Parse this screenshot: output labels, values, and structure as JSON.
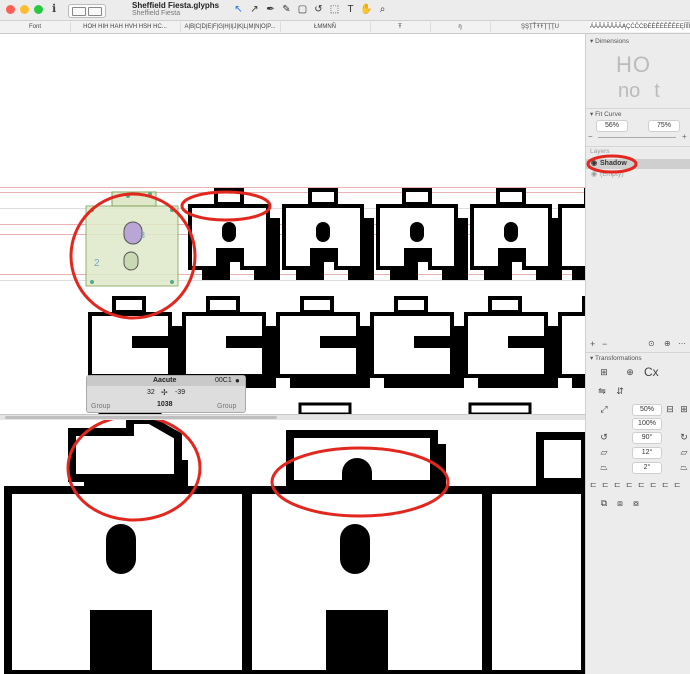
{
  "window": {
    "title": "Sheffield Fiesta.glyphs",
    "subtitle": "Sheffield Fiesta"
  },
  "tabs": [
    {
      "label": "Font"
    },
    {
      "label": "HOH HIH HAH HVH HSH HC..."
    },
    {
      "label": "A|B|C|D|E|F|G|H|I|J|K|L|M|N|O|P..."
    },
    {
      "label": "ŁMMNŇ"
    },
    {
      "label": "Ŧ"
    },
    {
      "label": "ŋ"
    },
    {
      "label": "ŞŞŢŤŦŦŢŢŢU"
    },
    {
      "label": "ÁÀÂÄÃÅĀĂĄÇĆĈĊĐÉÈÊËĒĚĔĖĘÍÌÎÏĨĮ..."
    }
  ],
  "toolbar": {
    "icons": [
      "select-arrow-icon",
      "select-arrow-alt-icon",
      "draw-pen-icon",
      "pencil-icon",
      "rectangle-icon",
      "rotate-icon",
      "scale-icon",
      "text-icon",
      "hand-icon",
      "zoom-icon"
    ],
    "glyphs": [
      "↖",
      "↗",
      "✒",
      "✎",
      "▢",
      "↺",
      "⬚",
      "T",
      "✋",
      "⌕"
    ]
  },
  "info_box": {
    "glyph_name": "Aacute",
    "unicode": "00C1",
    "x": "32",
    "y": "-39",
    "width": "1038",
    "left_label": "Group",
    "right_label": "Group"
  },
  "panel": {
    "dimensions_title": "Dimensions",
    "dimension_letters": [
      "H",
      "O",
      "n",
      "o",
      "t"
    ],
    "fit_curve_title": "Fit Curve",
    "fit_curve_min": "56%",
    "fit_curve_max": "75%",
    "layers_title": "Layers",
    "layers": [
      {
        "name": "Shadow",
        "selected": true
      },
      {
        "name": "(empty)",
        "selected": false
      }
    ],
    "transformations_title": "Transformations",
    "transform_letters": "Cx",
    "scale_percent": "50%",
    "scale_percent_2": "100%",
    "rotate_degrees": "90°",
    "slant_degrees": "12°",
    "skew_degrees": "2°"
  },
  "colors": {
    "accent": "#1e6bf2",
    "annotation_red": "#e2271f",
    "selected_layer": "#cfcfcf",
    "metric_line": "#e7b3b3"
  }
}
